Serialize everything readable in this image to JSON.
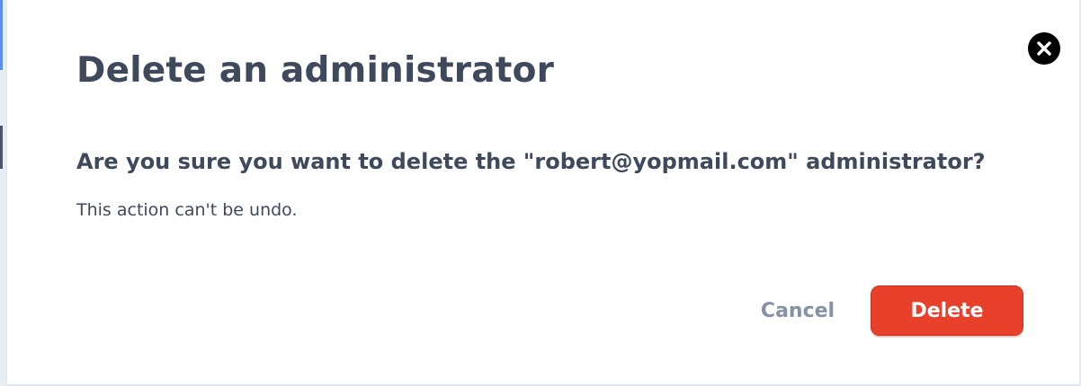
{
  "modal": {
    "title": "Delete an administrator",
    "question": "Are you sure you want to delete the \"robert@yopmail.com\" administrator?",
    "note": "This action can't be undo.",
    "close_icon": "close-icon",
    "cancel_label": "Cancel",
    "delete_label": "Delete"
  },
  "colors": {
    "heading_text": "#3e4a5c",
    "cancel_text": "#8592a3",
    "delete_button": "#e8402b",
    "close_button": "#000000"
  }
}
